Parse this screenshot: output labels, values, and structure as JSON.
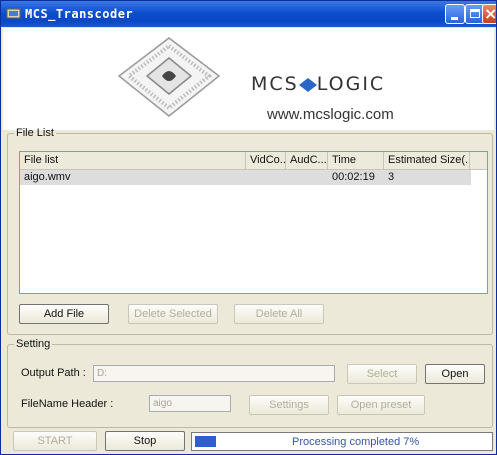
{
  "window": {
    "title": "MCS_Transcoder"
  },
  "banner": {
    "brand": "MCS LOGIC",
    "brand_left": "MCS",
    "brand_right": "LOGIC",
    "website": "www.mcslogic.com"
  },
  "file_list": {
    "group_label": "File List",
    "columns": [
      "File list",
      "VidCo...",
      "AudC...",
      "Time",
      "Estimated Size(..."
    ],
    "rows": [
      {
        "file": "aigo.wmv",
        "vid_codec": "",
        "aud_codec": "",
        "time": "00:02:19",
        "size": "3"
      }
    ],
    "buttons": {
      "add": "Add File",
      "delete_selected": "Delete Selected",
      "delete_all": "Delete All"
    }
  },
  "setting": {
    "group_label": "Setting",
    "output_path_label": "Output Path :",
    "output_path_value": "D:",
    "select_label": "Select",
    "open_label": "Open",
    "filename_header_label": "FileName Header :",
    "filename_header_value": "aigo",
    "settings_label": "Settings",
    "open_preset_label": "Open preset"
  },
  "bottom": {
    "start_label": "START",
    "stop_label": "Stop",
    "status_text": "Processing completed 7%",
    "progress": 0.07
  },
  "colors": {
    "titlebar": "#0a47c6",
    "progress_fill": "#2f5fcf",
    "window_bg": "#ece9d8"
  }
}
